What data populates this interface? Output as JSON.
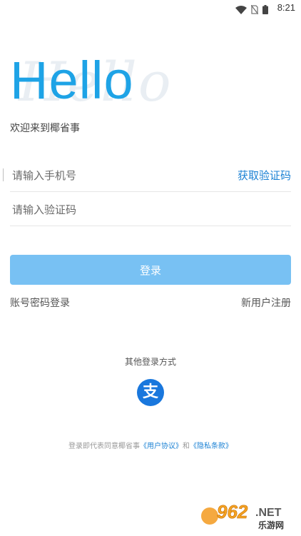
{
  "status_bar": {
    "time": "8:21",
    "icons": [
      "wifi-icon",
      "no-sim-icon",
      "battery-icon"
    ]
  },
  "hero": {
    "title": "Hello",
    "subtitle": "欢迎来到椰省事"
  },
  "form": {
    "phone_placeholder": "请输入手机号",
    "get_code_label": "获取验证码",
    "code_placeholder": "请输入验证码",
    "login_label": "登录",
    "password_login_label": "账号密码登录",
    "register_label": "新用户注册"
  },
  "other_login": {
    "title": "其他登录方式",
    "icon": "alipay-icon",
    "icon_glyph": "支"
  },
  "agreement": {
    "prefix": "登录即代表同意椰省事",
    "user_agreement": "《用户协议》",
    "and": "和",
    "privacy": "《隐私条款》"
  },
  "watermark": {
    "number": "962",
    "dot": ".NET",
    "subtitle": "乐游网"
  },
  "colors": {
    "accent": "#1ea3e6",
    "link": "#1c82d4",
    "button": "#78c1f3",
    "alipay": "#1977dd"
  }
}
